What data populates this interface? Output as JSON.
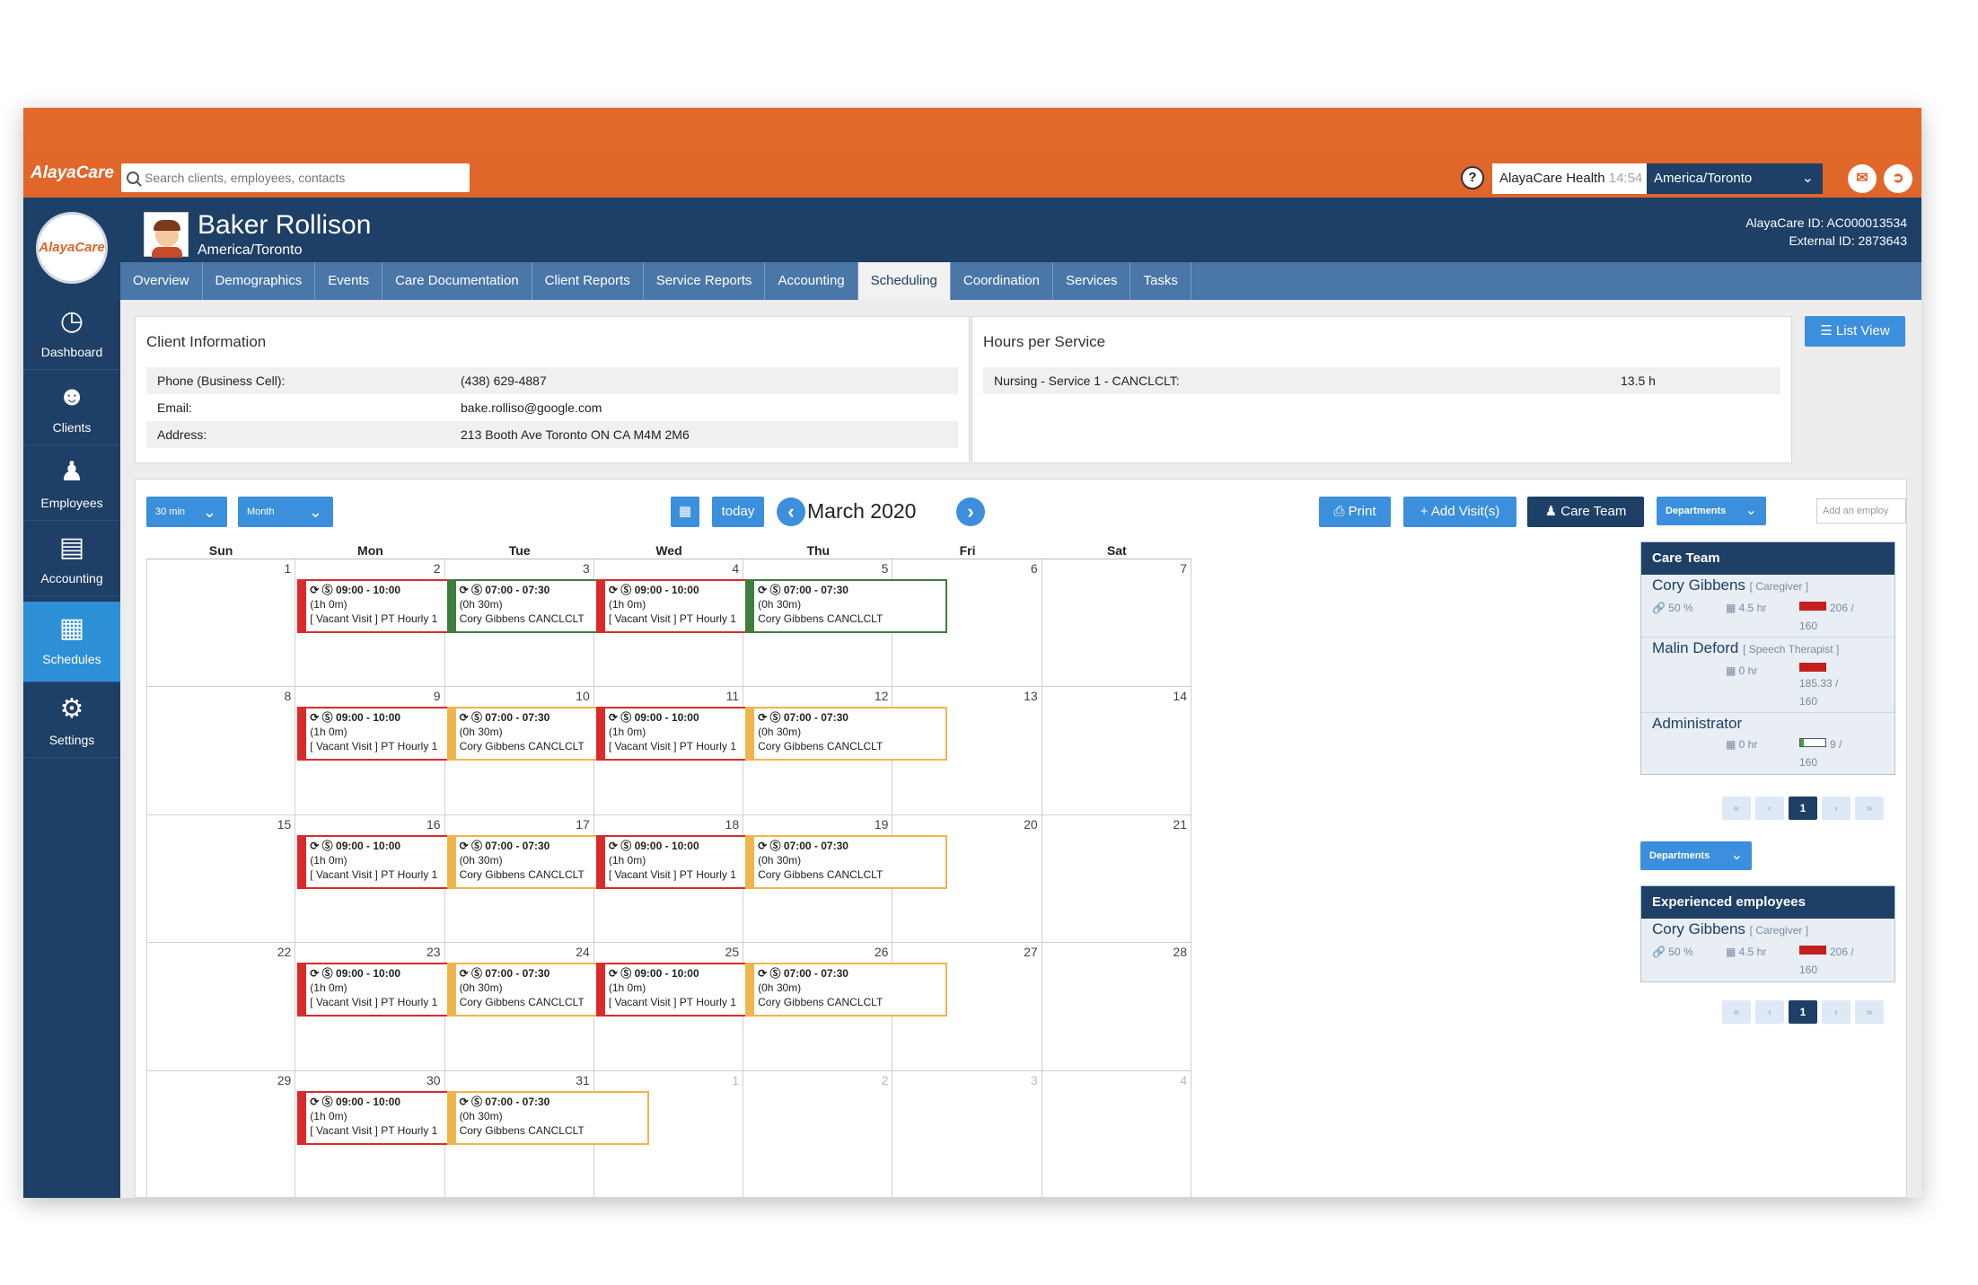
{
  "topbar": {
    "logo": "AlayaCare",
    "search_placeholder": "Search clients, employees, contacts",
    "help_icon": "?",
    "org_name": "AlayaCare Health",
    "org_time": "14:54",
    "timezone": "America/Toronto",
    "colors": {
      "accent": "#e0652a",
      "navy": "#1e3f66",
      "blue": "#3c8fdc"
    }
  },
  "leftnav": {
    "brand": "AlayaCare",
    "items": [
      {
        "label": "Dashboard",
        "icon": "dashboard-icon"
      },
      {
        "label": "Clients",
        "icon": "clients-icon"
      },
      {
        "label": "Employees",
        "icon": "employees-icon"
      },
      {
        "label": "Accounting",
        "icon": "accounting-icon"
      },
      {
        "label": "Schedules",
        "icon": "schedules-icon"
      },
      {
        "label": "Settings",
        "icon": "gear-icon"
      }
    ]
  },
  "patient": {
    "name": "Baker Rollison",
    "timezone": "America/Toronto",
    "alayacare_id": "AlayaCare ID: AC000013534",
    "external_id": "External ID: 2873643"
  },
  "tabs": [
    "Overview",
    "Demographics",
    "Events",
    "Care Documentation",
    "Client Reports",
    "Service Reports",
    "Accounting",
    "Scheduling",
    "Coordination",
    "Services",
    "Tasks"
  ],
  "active_tab": "Scheduling",
  "client_info": {
    "title": "Client Information",
    "rows": [
      {
        "label": "Phone (Business Cell):",
        "value": "(438) 629-4887"
      },
      {
        "label": "Email:",
        "value": "bake.rolliso@google.com"
      },
      {
        "label": "Address:",
        "value": "213 Booth Ave Toronto ON CA M4M 2M6"
      }
    ]
  },
  "hours": {
    "title": "Hours per Service",
    "rows": [
      {
        "label": "Nursing - Service 1 - CANCLCLT:",
        "value": "13.5 h"
      }
    ]
  },
  "list_view_label": "List View",
  "calendar": {
    "interval": "30 min",
    "view": "Month",
    "today_label": "today",
    "month_title": "March 2020",
    "print_label": "Print",
    "add_visit_label": "Add Visit(s)",
    "care_team_label": "Care Team",
    "departments_label": "Departments",
    "add_employee_placeholder": "Add an employ",
    "days": [
      "Sun",
      "Mon",
      "Tue",
      "Wed",
      "Thu",
      "Fri",
      "Sat"
    ],
    "weeks": [
      [
        {
          "n": "",
          "m": false
        },
        {
          "n": "1",
          "m": false
        },
        {
          "n": "2",
          "m": false
        },
        {
          "n": "3",
          "m": false
        },
        {
          "n": "4",
          "m": false
        },
        {
          "n": "5",
          "m": false
        },
        {
          "n": "6",
          "m": false
        },
        {
          "n": "7",
          "m": false
        }
      ],
      [
        {
          "n": "8"
        },
        {
          "n": "9"
        },
        {
          "n": "10"
        },
        {
          "n": "11"
        },
        {
          "n": "12"
        },
        {
          "n": "13"
        },
        {
          "n": "14"
        }
      ],
      [
        {
          "n": "15"
        },
        {
          "n": "16"
        },
        {
          "n": "17"
        },
        {
          "n": "18"
        },
        {
          "n": "19"
        },
        {
          "n": "20"
        },
        {
          "n": "21"
        }
      ],
      [
        {
          "n": "22"
        },
        {
          "n": "23"
        },
        {
          "n": "24"
        },
        {
          "n": "25"
        },
        {
          "n": "26"
        },
        {
          "n": "27"
        },
        {
          "n": "28"
        }
      ],
      [
        {
          "n": "29"
        },
        {
          "n": "30"
        },
        {
          "n": "31"
        },
        {
          "n": "1",
          "m": true
        },
        {
          "n": "2",
          "m": true
        },
        {
          "n": "3",
          "m": true
        },
        {
          "n": "4",
          "m": true
        }
      ]
    ],
    "visit_vacant": {
      "time": "09:00 - 10:00",
      "duration": "(1h 0m)",
      "desc": "[ Vacant Visit ] PT Hourly 1"
    },
    "visit_cory": {
      "time": "07:00 - 07:30",
      "duration": "(0h 30m)",
      "desc": "Cory Gibbens CANCLCLT"
    }
  },
  "care_team": {
    "title": "Care Team",
    "members": [
      {
        "name": "Cory Gibbens",
        "role": "[ Caregiver ]",
        "pct": "50 %",
        "hours": "4.5 hr",
        "ratio": "206 /",
        "total": "160"
      },
      {
        "name": "Malin Deford",
        "role": "[ Speech Therapist ]",
        "hours": "0 hr",
        "ratio": "185.33 /",
        "total": "160"
      },
      {
        "name": "Administrator",
        "role": "",
        "hours": "0 hr",
        "ratio": "9 /",
        "total": "160"
      }
    ],
    "page": "1"
  },
  "experienced": {
    "departments_label": "Departments",
    "title": "Experienced employees",
    "members": [
      {
        "name": "Cory Gibbens",
        "role": "[ Caregiver ]",
        "pct": "50 %",
        "hours": "4.5 hr",
        "ratio": "206 /",
        "total": "160"
      }
    ],
    "page": "1"
  }
}
